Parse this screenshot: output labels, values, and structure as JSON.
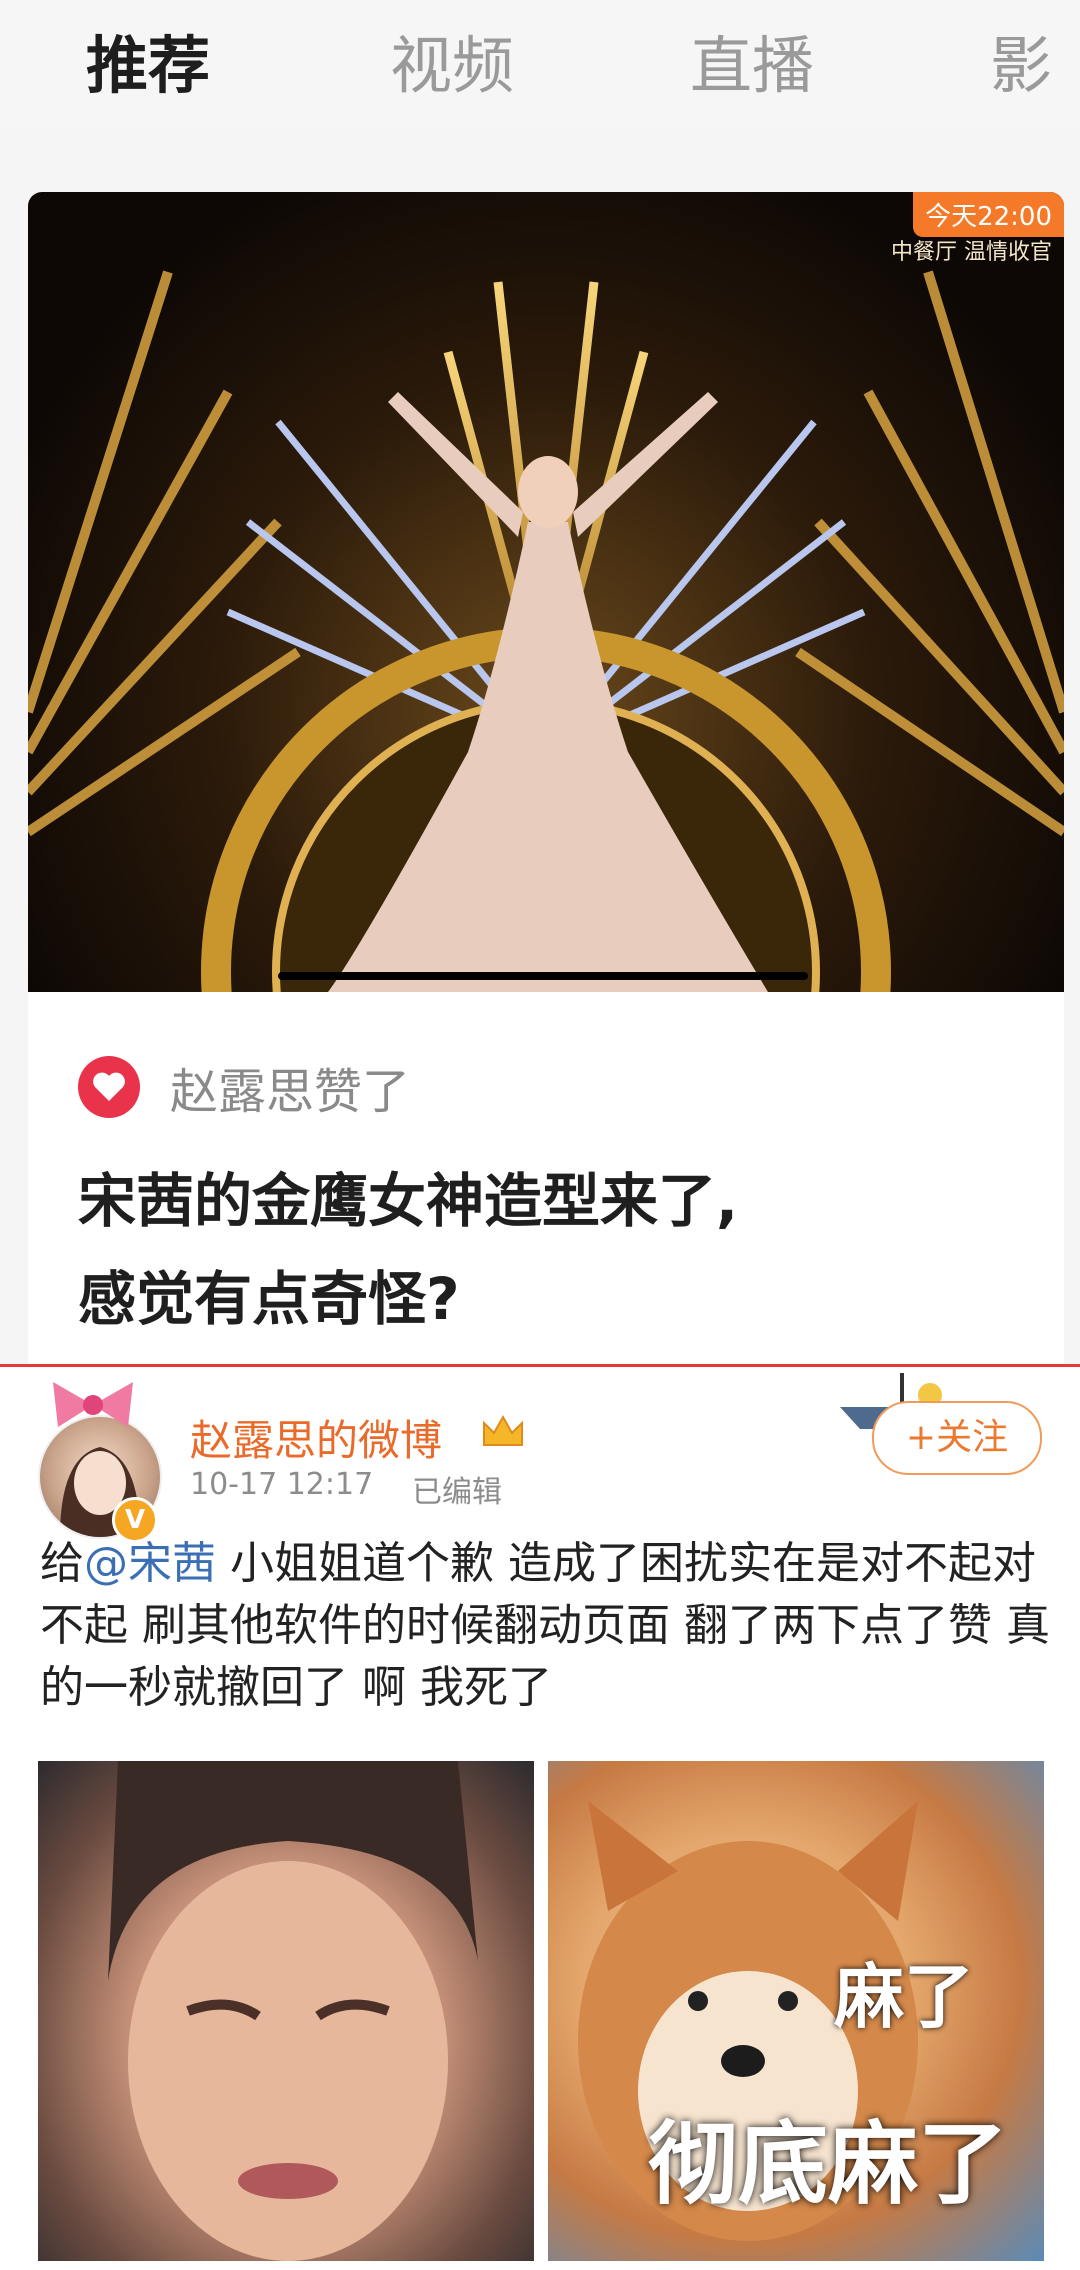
{
  "tabs": [
    {
      "label": "推荐",
      "active": true
    },
    {
      "label": "视频",
      "active": false
    },
    {
      "label": "直播",
      "active": false
    },
    {
      "label": "影",
      "active": false
    }
  ],
  "card": {
    "video": {
      "badge": "今天22:00",
      "channel": "中餐厅 温情收官"
    },
    "liked_by": "赵露思赞了",
    "headline_line1": "宋茜的金鹰女神造型来了,",
    "headline_line2": "感觉有点奇怪?"
  },
  "post": {
    "author": "赵露思的微博",
    "time": "10-17 12:17",
    "edited": "已编辑",
    "follow_label": "+关注",
    "text_prefix": "给",
    "mention": "@宋茜",
    "text_body": " 小姐姐道个歉 造成了困扰实在是对不起对不起 刷其他软件的时候翻动页面 翻了两下点了赞 真的一秒就撤回了  啊 我死了",
    "meme_top": "麻了",
    "meme_bottom": "彻底麻了",
    "verified_badge": "V"
  },
  "colors": {
    "accent_orange": "#ea6a2a",
    "heart_red": "#e8334a",
    "divider_red": "#e23b3b",
    "mention_blue": "#3b6fb5"
  }
}
